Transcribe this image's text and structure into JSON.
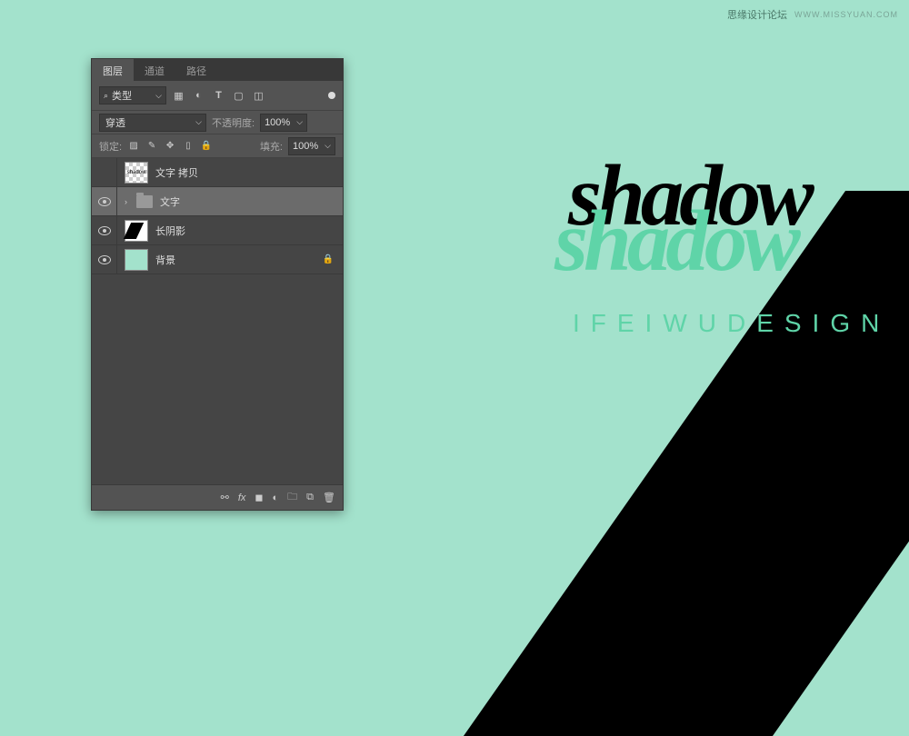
{
  "watermark": {
    "text": "思缘设计论坛",
    "url": "WWW.MISSYUAN.COM"
  },
  "artwork": {
    "main_text": "shadow",
    "sub_text": "IFEIWUDESIGN"
  },
  "panel": {
    "tabs": [
      "图层",
      "通道",
      "路径"
    ],
    "active_tab": 0,
    "filter": {
      "search_label": "类型"
    },
    "blend": {
      "mode": "穿透",
      "opacity_label": "不透明度:",
      "opacity_value": "100%"
    },
    "lock": {
      "label": "锁定:",
      "fill_label": "填充:",
      "fill_value": "100%"
    },
    "layers": [
      {
        "name": "文字 拷贝",
        "visible": false,
        "type": "text-copy"
      },
      {
        "name": "文字",
        "visible": true,
        "type": "folder",
        "selected": true
      },
      {
        "name": "长阴影",
        "visible": true,
        "type": "shadow"
      },
      {
        "name": "背景",
        "visible": true,
        "type": "bg",
        "locked": true
      }
    ]
  }
}
